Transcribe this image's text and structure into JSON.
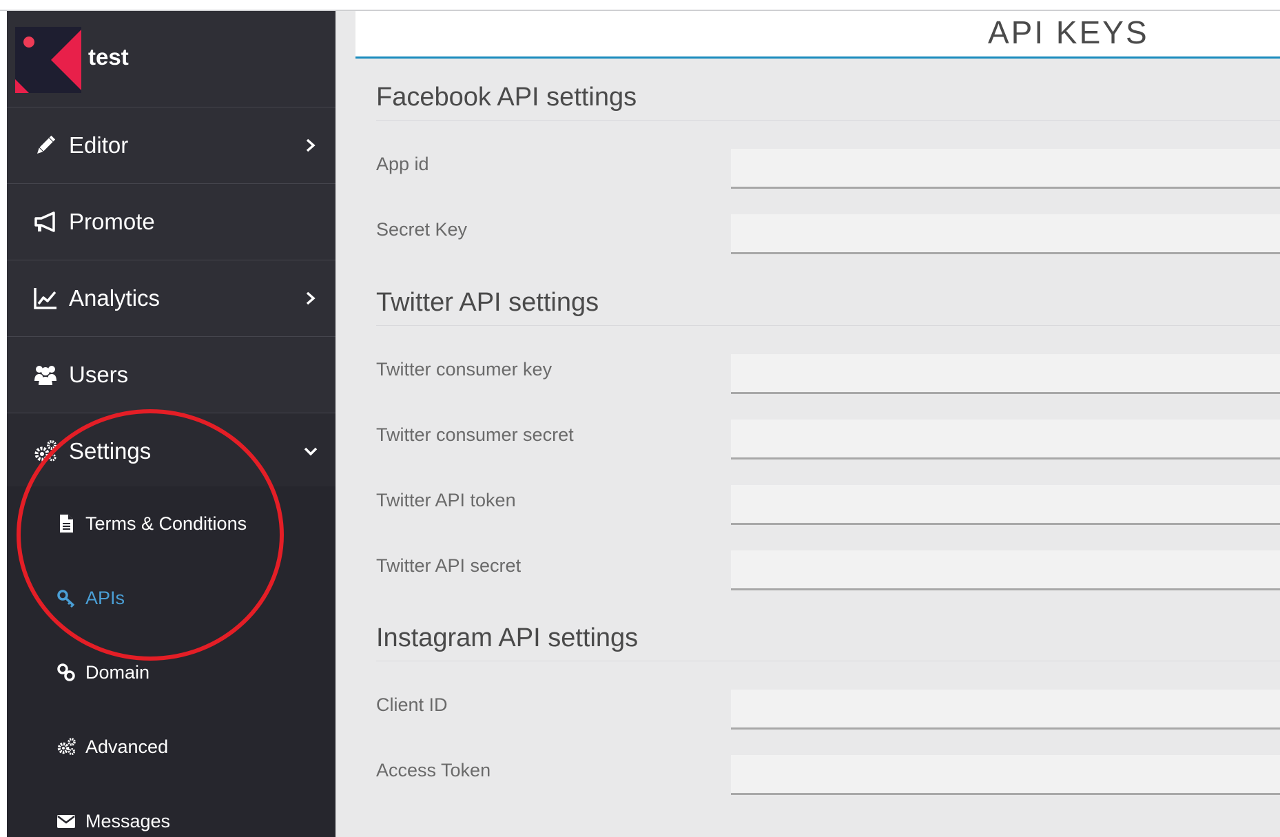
{
  "brand": {
    "name": "test"
  },
  "sidebar": {
    "items": [
      {
        "label": "Editor"
      },
      {
        "label": "Promote"
      },
      {
        "label": "Analytics"
      },
      {
        "label": "Users"
      },
      {
        "label": "Settings"
      }
    ],
    "settings_submenu": [
      {
        "label": "Terms & Conditions"
      },
      {
        "label": "APIs"
      },
      {
        "label": "Domain"
      },
      {
        "label": "Advanced"
      },
      {
        "label": "Messages"
      }
    ]
  },
  "header": {
    "title": "API KEYS"
  },
  "sections": {
    "facebook": {
      "title": "Facebook API settings",
      "fields": [
        {
          "label": "App id",
          "value": ""
        },
        {
          "label": "Secret Key",
          "value": ""
        }
      ]
    },
    "twitter": {
      "title": "Twitter API settings",
      "fields": [
        {
          "label": "Twitter consumer key",
          "value": ""
        },
        {
          "label": "Twitter consumer secret",
          "value": ""
        },
        {
          "label": "Twitter API token",
          "value": ""
        },
        {
          "label": "Twitter API secret",
          "value": ""
        }
      ]
    },
    "instagram": {
      "title": "Instagram API settings",
      "fields": [
        {
          "label": "Client ID",
          "value": ""
        },
        {
          "label": "Access Token",
          "value": ""
        }
      ]
    }
  },
  "colors": {
    "sidebar_bg": "#2f2f36",
    "submenu_bg": "#26262d",
    "accent": "#1a8bbd",
    "selected_link": "#4a9fd6",
    "annotation": "#e41e26",
    "logo_pink": "#e8204a"
  }
}
